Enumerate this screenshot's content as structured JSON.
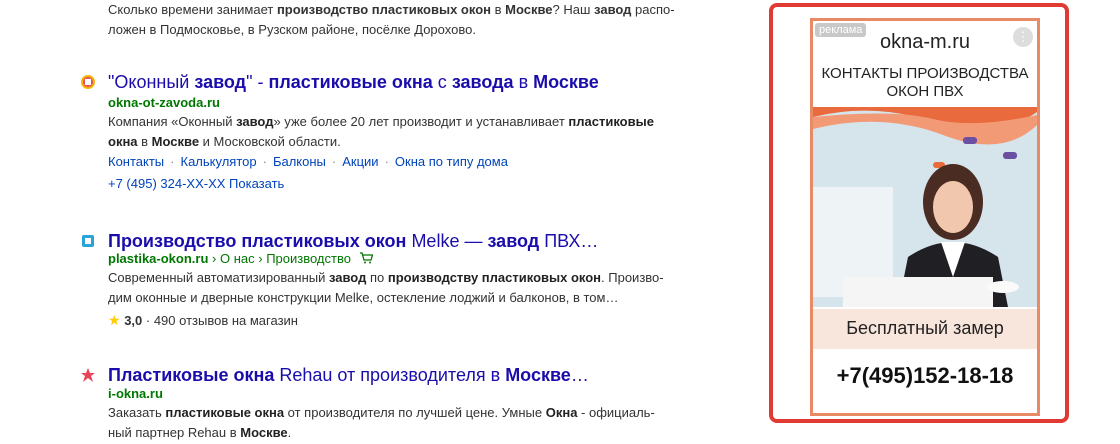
{
  "top_snippet": {
    "line1_a": "Сколько времени занимает ",
    "line1_b": "производство пластиковых окон",
    "line1_c": " в ",
    "line1_d": "Москве",
    "line1_e": "? Наш ",
    "line1_f": "завод",
    "line1_g": " распо-",
    "line2": "ложен в Подмосковье, в Рузском районе, посёлке Дорохово."
  },
  "results": [
    {
      "title_a": "\"Оконный ",
      "title_b": "завод",
      "title_c": "\" - ",
      "title_d": "пластиковые окна",
      "title_e": " с ",
      "title_f": "завода",
      "title_g": " в ",
      "title_h": "Москве",
      "url": "okna-ot-zavoda.ru",
      "text1_a": "Компания «Оконный ",
      "text1_b": "завод",
      "text1_c": "» уже более 20 лет производит и устанавливает ",
      "text1_d": "пластиковые",
      "text2_a": "окна",
      "text2_b": " в ",
      "text2_c": "Москве",
      "text2_d": " и Московской области.",
      "sitelinks": [
        "Контакты",
        "Калькулятор",
        "Балконы",
        "Акции",
        "Окна по типу дома"
      ],
      "phone": "+7 (495) 324-XX-XX Показать"
    },
    {
      "title_a": "Производство пластиковых окон",
      "title_b": " Melke — ",
      "title_c": "завод",
      "title_d": " ПВХ…",
      "url": "plastika-okon.ru",
      "crumb1": "О нас",
      "crumb2": "Производство",
      "text1_a": "Современный автоматизированный ",
      "text1_b": "завод",
      "text1_c": " по ",
      "text1_d": "производству пластиковых окон",
      "text1_e": ". Произво-",
      "text2": "дим оконные и дверные конструкции Melke, остекление лоджий и балконов, в том…",
      "rating": "3,0",
      "reviews": "· 490 отзывов на магазин"
    },
    {
      "title_a": "Пластиковые окна",
      "title_b": " Rehau от производителя в ",
      "title_c": "Москве",
      "title_d": "…",
      "url": "i-okna.ru",
      "text1_a": "Заказать ",
      "text1_b": "пластиковые окна",
      "text1_c": " от производителя по лучшей цене. Умные ",
      "text1_d": "Окна",
      "text1_e": " - официаль-",
      "text2_a": "ный партнер Rehau в ",
      "text2_b": "Москве",
      "text2_c": "."
    }
  ],
  "ad": {
    "badge": "реклама",
    "domain": "okna-m.ru",
    "more": "⋮",
    "head1": "КОНТАКТЫ ПРОИЗВОДСТВА",
    "head2": "ОКОН ПВХ",
    "free": "Бесплатный замер",
    "phone": "+7(495)152-18-18"
  },
  "colors": {
    "link": "#1a0dab",
    "url": "#007700",
    "ad_border": "#e03a33"
  }
}
